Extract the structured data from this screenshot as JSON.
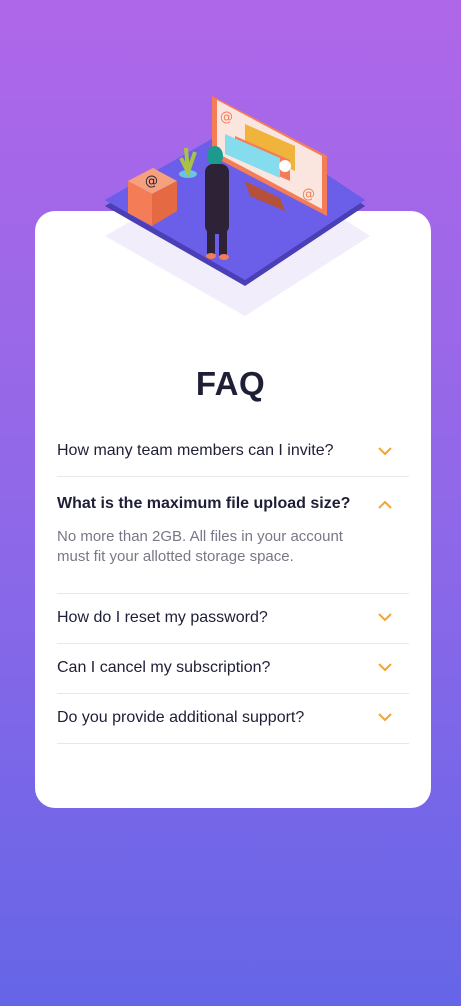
{
  "faq": {
    "title": "FAQ",
    "items": [
      {
        "question": "How many team members can I invite?",
        "expanded": false
      },
      {
        "question": "What is the maximum file upload size?",
        "expanded": true,
        "answer": "No more than 2GB. All files in your account must fit your allotted storage space."
      },
      {
        "question": "How do I reset my password?",
        "expanded": false
      },
      {
        "question": "Can I cancel my subscription?",
        "expanded": false
      },
      {
        "question": "Do you provide additional support?",
        "expanded": false
      }
    ]
  },
  "colors": {
    "accent": "#f47c57",
    "chevron": "#f3a531",
    "heading": "#1e1f36",
    "muted": "#787887",
    "bg_top": "#af67e9",
    "bg_bottom": "#6565e7"
  },
  "icons": {
    "chevron_collapsed": "chevron-down-icon",
    "chevron_expanded": "chevron-up-icon"
  }
}
